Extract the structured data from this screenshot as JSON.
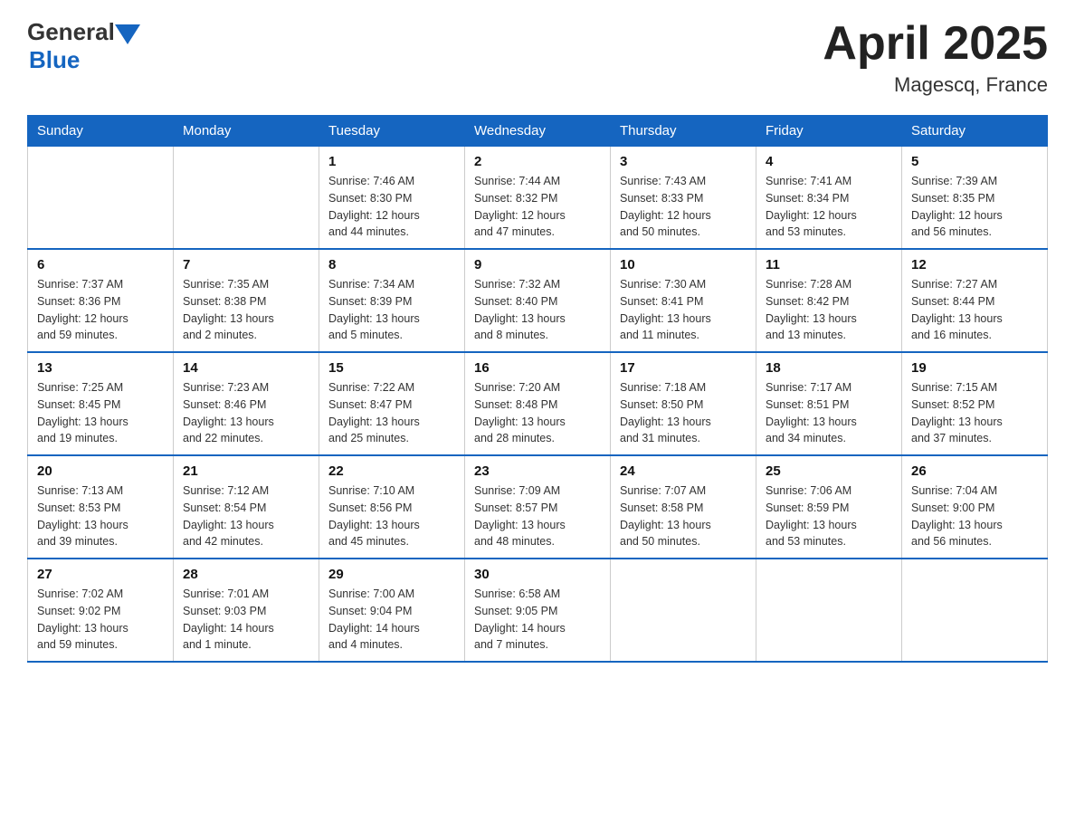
{
  "logo": {
    "general": "General",
    "blue": "Blue"
  },
  "title": "April 2025",
  "subtitle": "Magescq, France",
  "headers": [
    "Sunday",
    "Monday",
    "Tuesday",
    "Wednesday",
    "Thursday",
    "Friday",
    "Saturday"
  ],
  "weeks": [
    [
      {
        "day": "",
        "info": ""
      },
      {
        "day": "",
        "info": ""
      },
      {
        "day": "1",
        "info": "Sunrise: 7:46 AM\nSunset: 8:30 PM\nDaylight: 12 hours\nand 44 minutes."
      },
      {
        "day": "2",
        "info": "Sunrise: 7:44 AM\nSunset: 8:32 PM\nDaylight: 12 hours\nand 47 minutes."
      },
      {
        "day": "3",
        "info": "Sunrise: 7:43 AM\nSunset: 8:33 PM\nDaylight: 12 hours\nand 50 minutes."
      },
      {
        "day": "4",
        "info": "Sunrise: 7:41 AM\nSunset: 8:34 PM\nDaylight: 12 hours\nand 53 minutes."
      },
      {
        "day": "5",
        "info": "Sunrise: 7:39 AM\nSunset: 8:35 PM\nDaylight: 12 hours\nand 56 minutes."
      }
    ],
    [
      {
        "day": "6",
        "info": "Sunrise: 7:37 AM\nSunset: 8:36 PM\nDaylight: 12 hours\nand 59 minutes."
      },
      {
        "day": "7",
        "info": "Sunrise: 7:35 AM\nSunset: 8:38 PM\nDaylight: 13 hours\nand 2 minutes."
      },
      {
        "day": "8",
        "info": "Sunrise: 7:34 AM\nSunset: 8:39 PM\nDaylight: 13 hours\nand 5 minutes."
      },
      {
        "day": "9",
        "info": "Sunrise: 7:32 AM\nSunset: 8:40 PM\nDaylight: 13 hours\nand 8 minutes."
      },
      {
        "day": "10",
        "info": "Sunrise: 7:30 AM\nSunset: 8:41 PM\nDaylight: 13 hours\nand 11 minutes."
      },
      {
        "day": "11",
        "info": "Sunrise: 7:28 AM\nSunset: 8:42 PM\nDaylight: 13 hours\nand 13 minutes."
      },
      {
        "day": "12",
        "info": "Sunrise: 7:27 AM\nSunset: 8:44 PM\nDaylight: 13 hours\nand 16 minutes."
      }
    ],
    [
      {
        "day": "13",
        "info": "Sunrise: 7:25 AM\nSunset: 8:45 PM\nDaylight: 13 hours\nand 19 minutes."
      },
      {
        "day": "14",
        "info": "Sunrise: 7:23 AM\nSunset: 8:46 PM\nDaylight: 13 hours\nand 22 minutes."
      },
      {
        "day": "15",
        "info": "Sunrise: 7:22 AM\nSunset: 8:47 PM\nDaylight: 13 hours\nand 25 minutes."
      },
      {
        "day": "16",
        "info": "Sunrise: 7:20 AM\nSunset: 8:48 PM\nDaylight: 13 hours\nand 28 minutes."
      },
      {
        "day": "17",
        "info": "Sunrise: 7:18 AM\nSunset: 8:50 PM\nDaylight: 13 hours\nand 31 minutes."
      },
      {
        "day": "18",
        "info": "Sunrise: 7:17 AM\nSunset: 8:51 PM\nDaylight: 13 hours\nand 34 minutes."
      },
      {
        "day": "19",
        "info": "Sunrise: 7:15 AM\nSunset: 8:52 PM\nDaylight: 13 hours\nand 37 minutes."
      }
    ],
    [
      {
        "day": "20",
        "info": "Sunrise: 7:13 AM\nSunset: 8:53 PM\nDaylight: 13 hours\nand 39 minutes."
      },
      {
        "day": "21",
        "info": "Sunrise: 7:12 AM\nSunset: 8:54 PM\nDaylight: 13 hours\nand 42 minutes."
      },
      {
        "day": "22",
        "info": "Sunrise: 7:10 AM\nSunset: 8:56 PM\nDaylight: 13 hours\nand 45 minutes."
      },
      {
        "day": "23",
        "info": "Sunrise: 7:09 AM\nSunset: 8:57 PM\nDaylight: 13 hours\nand 48 minutes."
      },
      {
        "day": "24",
        "info": "Sunrise: 7:07 AM\nSunset: 8:58 PM\nDaylight: 13 hours\nand 50 minutes."
      },
      {
        "day": "25",
        "info": "Sunrise: 7:06 AM\nSunset: 8:59 PM\nDaylight: 13 hours\nand 53 minutes."
      },
      {
        "day": "26",
        "info": "Sunrise: 7:04 AM\nSunset: 9:00 PM\nDaylight: 13 hours\nand 56 minutes."
      }
    ],
    [
      {
        "day": "27",
        "info": "Sunrise: 7:02 AM\nSunset: 9:02 PM\nDaylight: 13 hours\nand 59 minutes."
      },
      {
        "day": "28",
        "info": "Sunrise: 7:01 AM\nSunset: 9:03 PM\nDaylight: 14 hours\nand 1 minute."
      },
      {
        "day": "29",
        "info": "Sunrise: 7:00 AM\nSunset: 9:04 PM\nDaylight: 14 hours\nand 4 minutes."
      },
      {
        "day": "30",
        "info": "Sunrise: 6:58 AM\nSunset: 9:05 PM\nDaylight: 14 hours\nand 7 minutes."
      },
      {
        "day": "",
        "info": ""
      },
      {
        "day": "",
        "info": ""
      },
      {
        "day": "",
        "info": ""
      }
    ]
  ]
}
